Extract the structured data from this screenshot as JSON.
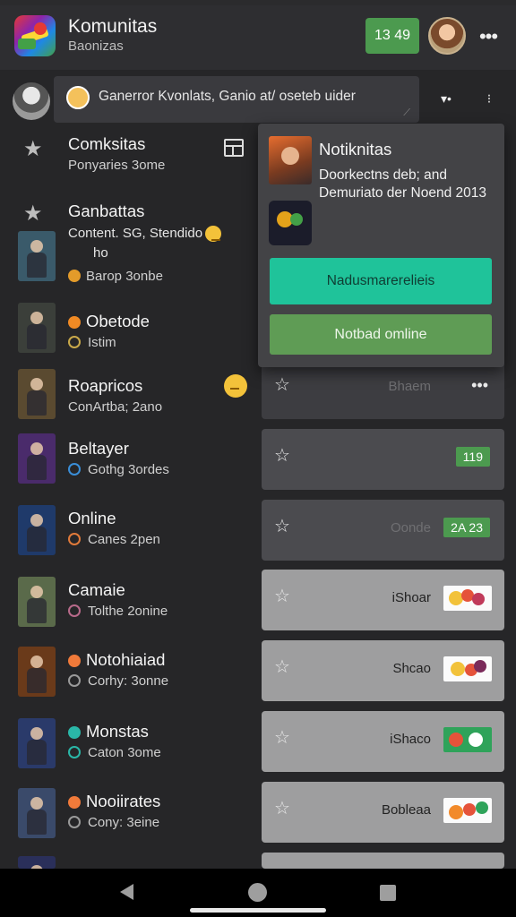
{
  "header": {
    "title": "Komunitas",
    "subtitle": "Baonizas",
    "badge": "13 49"
  },
  "search": {
    "text": "Ganerror Kvonlats, Ganio at/ oseteb uider"
  },
  "list": [
    {
      "title": "Comksitas",
      "subtitle": "Ponyaries 3ome",
      "icon": "star-icon"
    },
    {
      "title": "Ganbattas",
      "subtitle": "",
      "icon": "star-icon"
    },
    {
      "title": "Content. SG, Stendido",
      "subtitle": "Barop 3onbe",
      "extra": "ho",
      "thumb": "#3a5a6a"
    },
    {
      "title": "Obetode",
      "subtitle": "Istim",
      "thumb": "#3b3f3a"
    },
    {
      "title": "Roapricos",
      "subtitle": "ConArtba; 2ano",
      "thumb": "#5a4a30"
    },
    {
      "title": "Beltayer",
      "subtitle": "Gothg 3ordes",
      "thumb": "#4a2b6b"
    },
    {
      "title": "Online",
      "subtitle": "Canes 2pen",
      "thumb": "#1f3a6a"
    },
    {
      "title": "Camaie",
      "subtitle": "Tolthe 2onine",
      "thumb": "#5a6a4a"
    },
    {
      "title": "Notohiaiad",
      "subtitle": "Corhy: 3onne",
      "thumb": "#6a3a1a"
    },
    {
      "title": "Monstas",
      "subtitle": "Caton 3ome",
      "thumb": "#2a3a6a"
    },
    {
      "title": "Nooiirates",
      "subtitle": "Cony: 3eine",
      "thumb": "#3a4a6a"
    }
  ],
  "cards": [
    {
      "label": "Bhaem",
      "badge": "",
      "more": "•••"
    },
    {
      "label": "",
      "badge": "119"
    },
    {
      "label": "Oonde",
      "badge": "2A 23"
    },
    {
      "label": "iShoar"
    },
    {
      "label": "Shcao"
    },
    {
      "label": "iShaco"
    },
    {
      "label": "Bobleaa"
    }
  ],
  "popup": {
    "title": "Notiknitas",
    "body": "Doorkectns deb; and Demuriato der Noend 2013",
    "primary_button": "Nadusmarerelieis",
    "secondary_button": "Notbad omline"
  },
  "colors": {
    "accent_teal": "#1fc39a",
    "accent_green": "#5f9c55",
    "badge_green": "#4c9a4f",
    "background": "#262628"
  }
}
